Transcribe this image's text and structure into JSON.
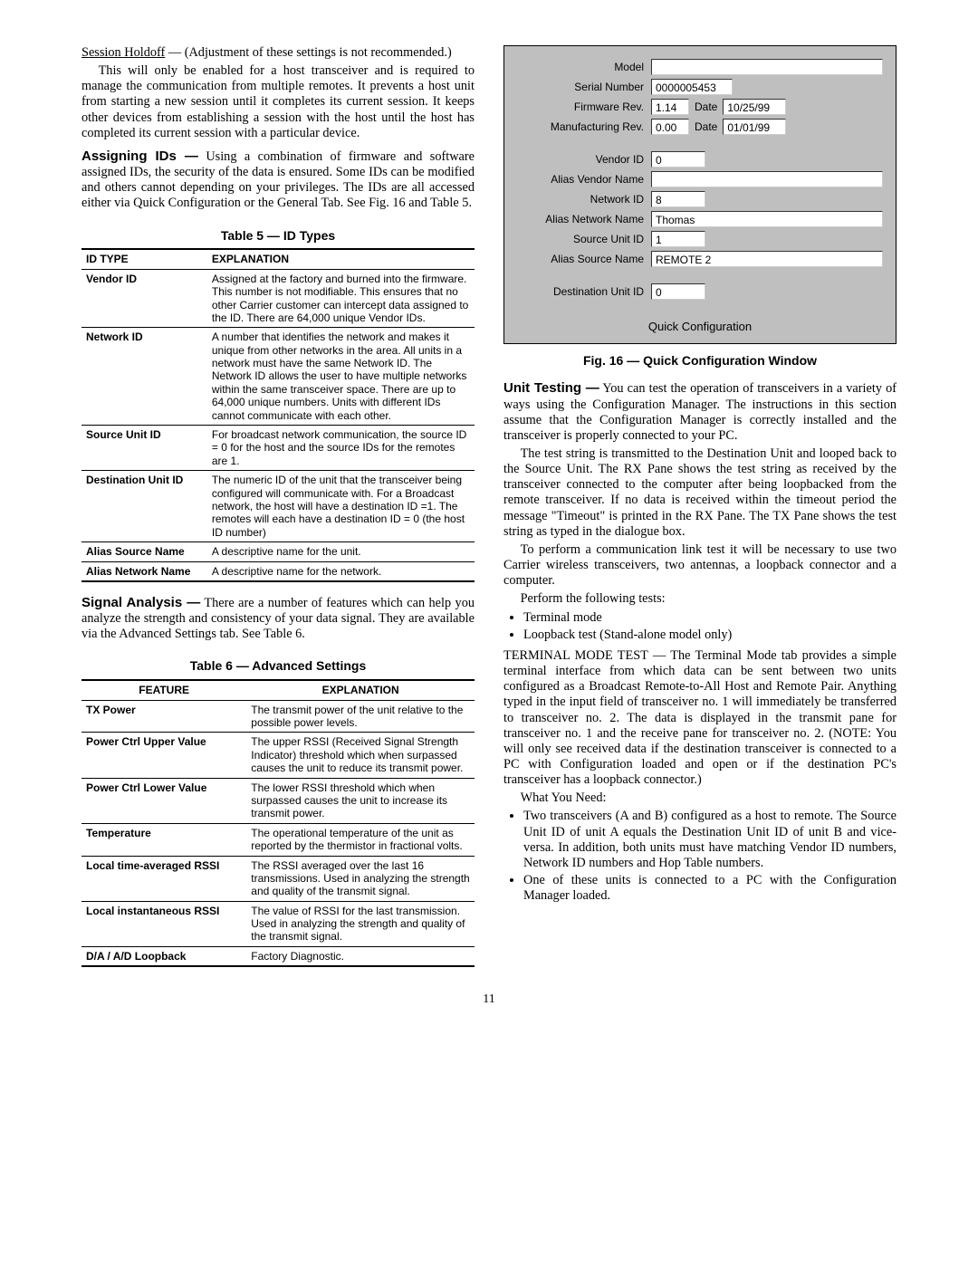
{
  "col1": {
    "session_holdoff_label": "Session Holdoff",
    "session_holdoff_tail": " — (Adjustment of these settings is not recommended.)",
    "p2": "This will only be enabled for a host transceiver and is required to manage the communication from multiple remotes. It prevents a host unit from starting a new session until it completes its current session. It keeps other devices from establishing a session with the host until the host has completed its current session with a particular device.",
    "assigning_heading": "Assigning IDs —",
    "assigning_body": " Using a combination of firmware and software assigned IDs, the security of the data is ensured. Some IDs can be modified and others cannot depending on your privileges. The IDs are all accessed either via Quick Configuration or the General Tab. See Fig. 16 and Table 5.",
    "table5_title": "Table 5 — ID Types",
    "table5_head": {
      "c1": "ID TYPE",
      "c2": "EXPLANATION"
    },
    "table5_rows": [
      {
        "c1": "Vendor ID",
        "c2": "Assigned at the factory and burned into the firmware. This number is not modifiable. This ensures that no other Carrier customer can intercept data assigned to the ID. There are 64,000 unique Vendor IDs."
      },
      {
        "c1": "Network ID",
        "c2": "A number that identifies the network and makes it unique from other networks in the area. All units in a network must have the same Network ID. The Network ID allows the user to have multiple networks within the same transceiver space. There are up to 64,000 unique numbers. Units with different IDs cannot communicate with each other."
      },
      {
        "c1": "Source Unit ID",
        "c2": "For broadcast network communication, the source ID = 0 for the host and the source IDs for the remotes are 1."
      },
      {
        "c1": "Destination Unit ID",
        "c2": "The numeric ID of the unit that the transceiver being configured will communicate with. For a Broadcast network, the host will have a destination ID =1. The remotes will each have a destination ID = 0 (the host ID number)"
      },
      {
        "c1": "Alias Source Name",
        "c2": "A descriptive name for the unit."
      },
      {
        "c1": "Alias Network Name",
        "c2": "A descriptive name for the network."
      }
    ],
    "signal_heading": "Signal Analysis —",
    "signal_body": " There are a number of features which can help you analyze the strength and consistency of your data signal. They are available via the Advanced Settings tab. See Table 6.",
    "table6_title": "Table 6 — Advanced Settings",
    "table6_head": {
      "c1": "FEATURE",
      "c2": "EXPLANATION"
    },
    "table6_rows": [
      {
        "c1": "TX Power",
        "c2": "The transmit power of the unit relative to the possible power levels."
      },
      {
        "c1": "Power Ctrl Upper Value",
        "c2": "The upper RSSI (Received Signal Strength Indicator) threshold which when surpassed causes the unit to reduce its transmit power."
      },
      {
        "c1": "Power Ctrl Lower Value",
        "c2": "The lower RSSI threshold which when surpassed causes the unit to increase its transmit power."
      },
      {
        "c1": "Temperature",
        "c2": "The operational temperature of the unit as reported by the thermistor in fractional volts."
      },
      {
        "c1": "Local time-averaged RSSI",
        "c2": "The RSSI averaged over the last 16 transmissions. Used in analyzing the strength and quality of the transmit signal."
      },
      {
        "c1": "Local instantaneous RSSI",
        "c2": "The value of RSSI for the last transmission. Used in analyzing the strength and quality of the transmit signal."
      },
      {
        "c1": "D/A / A/D Loopback",
        "c2": "Factory Diagnostic."
      }
    ]
  },
  "fig": {
    "labels": {
      "model": "Model",
      "serial": "Serial Number",
      "fw": "Firmware Rev.",
      "date": "Date",
      "mfg": "Manufacturing Rev.",
      "vendor": "Vendor ID",
      "aliasVendor": "Alias Vendor Name",
      "network": "Network ID",
      "aliasNetwork": "Alias Network Name",
      "source": "Source Unit ID",
      "aliasSource": "Alias Source Name",
      "dest": "Destination Unit ID",
      "qc": "Quick Configuration"
    },
    "values": {
      "model": "",
      "serial": "0000005453",
      "fw": "1.14",
      "fw_date": "10/25/99",
      "mfg": "0.00",
      "mfg_date": "01/01/99",
      "vendor": "0",
      "aliasVendor": "",
      "network": "8",
      "aliasNetwork": "Thomas",
      "source": "1",
      "aliasSource": "REMOTE 2",
      "dest": "0"
    },
    "caption": "Fig. 16 — Quick Configuration Window"
  },
  "col2": {
    "unit_heading": "Unit Testing —",
    "unit_body": " You can test the operation of transceivers in a variety of ways using the Configuration Manager. The instructions in this section assume that the Configuration Manager is correctly installed and the transceiver is properly connected to your PC.",
    "p2": "The test string is transmitted to the Destination Unit and looped back to the Source Unit. The RX Pane shows the test string as received by the transceiver connected to the computer after being loopbacked from the remote transceiver. If no data is received within the timeout period the message \"Timeout\" is printed in the RX Pane. The TX Pane shows the test string as typed in the dialogue box.",
    "p3": "To perform a communication link test it will be necessary to use two Carrier wireless transceivers, two antennas, a loopback connector and a computer.",
    "p4": "Perform the following tests:",
    "tests": [
      "Terminal mode",
      "Loopback test (Stand-alone model only)"
    ],
    "term_label": "TERMINAL MODE TEST",
    "term_body": " — The Terminal Mode tab provides a simple terminal interface from which data can be sent between two units configured as a Broadcast Remote-to-All Host and Remote Pair. Anything typed in the input field of transceiver no. 1 will immediately be transferred to transceiver no. 2. The data is displayed in the transmit pane for transceiver no. 1 and the receive pane for transceiver no. 2. (NOTE: You will only see received data if the destination transceiver is connected to a PC with Configuration loaded and open or if the destination PC's transceiver has a loopback connector.)",
    "wyn": "What You Need:",
    "needs": [
      "Two transceivers (A and B) configured as a host to remote. The Source Unit ID of unit A equals the Destination Unit ID of unit B and vice-versa. In addition, both units must have matching Vendor ID numbers, Network ID numbers and Hop Table numbers.",
      "One of these units is connected to a PC with the Configuration Manager loaded."
    ]
  },
  "pagenum": "11"
}
